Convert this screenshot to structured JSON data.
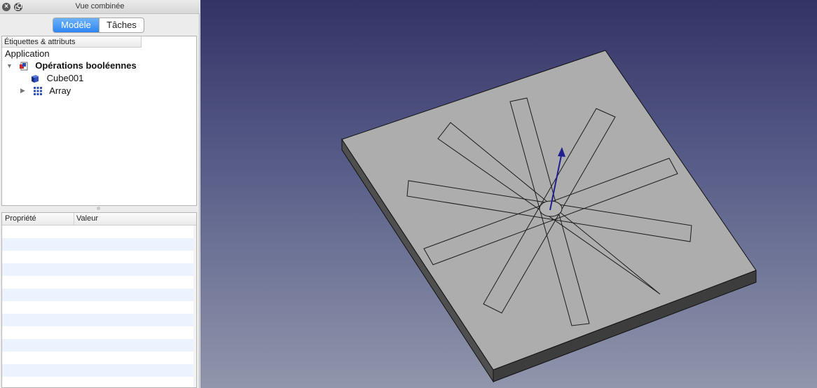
{
  "window": {
    "title": "Vue combinée",
    "close_glyph": "×"
  },
  "tabs": [
    {
      "label": "Modèle",
      "active": true
    },
    {
      "label": "Tâches",
      "active": false
    }
  ],
  "tree": {
    "column_header": "Étiquettes & attributs",
    "root_label": "Application",
    "items": [
      {
        "label": "Opérations booléennes",
        "icon": "document-icon",
        "expanded": true,
        "bold": true
      },
      {
        "label": "Cube001",
        "icon": "cube-icon",
        "expanded": false
      },
      {
        "label": "Array",
        "icon": "array-icon",
        "expanded": false
      }
    ],
    "expanded_arrow": "▼",
    "collapsed_arrow": "▶"
  },
  "properties": {
    "columns": [
      "Propriété",
      "Valeur"
    ]
  },
  "colors": {
    "tab_active": "#2e86f2",
    "selection_alt_row": "#edf3fe",
    "viewport_top": "#333366",
    "viewport_bottom": "#9096ab",
    "model_top_face": "#adadad",
    "model_side_face": "#4f4f4f",
    "axis_arrow": "#1f1f8f"
  },
  "viewport": {
    "content": "3D model view"
  }
}
